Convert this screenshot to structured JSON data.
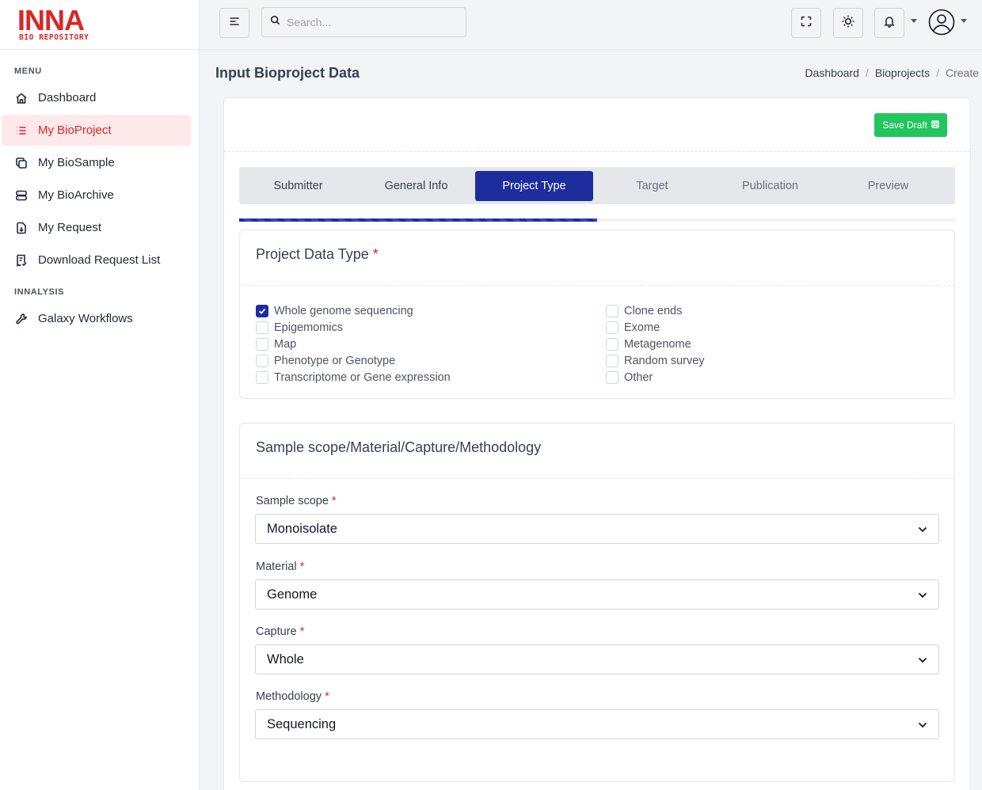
{
  "brand": {
    "logo_text": "INNA",
    "logo_subtitle": "BIO REPOSITORY",
    "color": "#dc2626"
  },
  "sidebar": {
    "sections": [
      {
        "label": "MENU"
      },
      {
        "label": "INNALYSIS"
      }
    ],
    "items": [
      {
        "label": "Dashboard",
        "icon": "home-icon"
      },
      {
        "label": "My BioProject",
        "icon": "list-icon",
        "active": true
      },
      {
        "label": "My BioSample",
        "icon": "copy-icon"
      },
      {
        "label": "My BioArchive",
        "icon": "server-icon"
      },
      {
        "label": "My Request",
        "icon": "file-download-icon"
      },
      {
        "label": "Download Request List",
        "icon": "receipt-icon"
      },
      {
        "label": "Galaxy Workflows",
        "icon": "tools-icon"
      }
    ]
  },
  "topbar": {
    "search_placeholder": "Search..."
  },
  "page": {
    "title": "Input Bioproject Data",
    "breadcrumb": [
      "Dashboard",
      "Bioprojects",
      "Create"
    ]
  },
  "toolbar": {
    "save_draft_label": "Save Draft"
  },
  "steps": [
    {
      "label": "Submitter",
      "state": "done"
    },
    {
      "label": "General Info",
      "state": "done"
    },
    {
      "label": "Project Type",
      "state": "active"
    },
    {
      "label": "Target",
      "state": "pending"
    },
    {
      "label": "Publication",
      "state": "pending"
    },
    {
      "label": "Preview",
      "state": "pending"
    }
  ],
  "step_progress_fraction": 0.5,
  "project_data_type": {
    "title": "Project Data Type",
    "required_mark": "*",
    "options_left": [
      {
        "label": "Whole genome sequencing",
        "checked": true
      },
      {
        "label": "Epigemomics",
        "checked": false
      },
      {
        "label": "Map",
        "checked": false
      },
      {
        "label": "Phenotype or Genotype",
        "checked": false
      },
      {
        "label": "Transcriptome or Gene expression",
        "checked": false
      }
    ],
    "options_right": [
      {
        "label": "Clone ends",
        "checked": false
      },
      {
        "label": "Exome",
        "checked": false
      },
      {
        "label": "Metagenome",
        "checked": false
      },
      {
        "label": "Random survey",
        "checked": false
      },
      {
        "label": "Other",
        "checked": false
      }
    ]
  },
  "sample_scope": {
    "title": "Sample scope/Material/Capture/Methodology",
    "fields": {
      "scope": {
        "label": "Sample scope",
        "value": "Monoisolate"
      },
      "material": {
        "label": "Material",
        "value": "Genome"
      },
      "capture": {
        "label": "Capture",
        "value": "Whole"
      },
      "methodology": {
        "label": "Methodology",
        "value": "Sequencing"
      }
    }
  }
}
